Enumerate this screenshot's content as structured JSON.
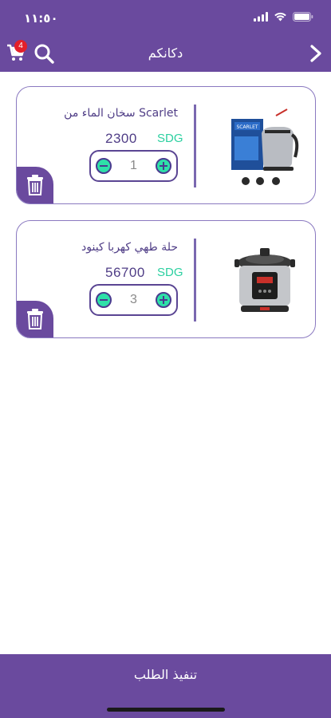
{
  "status": {
    "time": "١١:٥٠"
  },
  "header": {
    "title": "دكانكم",
    "cart_count": "4"
  },
  "cart": {
    "items": [
      {
        "name": "سخان الماء من Scarlet",
        "price": "2300",
        "currency": "SDG",
        "quantity": "1"
      },
      {
        "name": "حلة طهي كهربا كينود",
        "price": "56700",
        "currency": "SDG",
        "quantity": "3"
      }
    ]
  },
  "footer": {
    "checkout_label": "تنفيذ الطلب"
  },
  "colors": {
    "primary": "#6a4a9e",
    "accent": "#2bd0a0",
    "badge": "#e4202a",
    "text": "#4f3d86"
  }
}
